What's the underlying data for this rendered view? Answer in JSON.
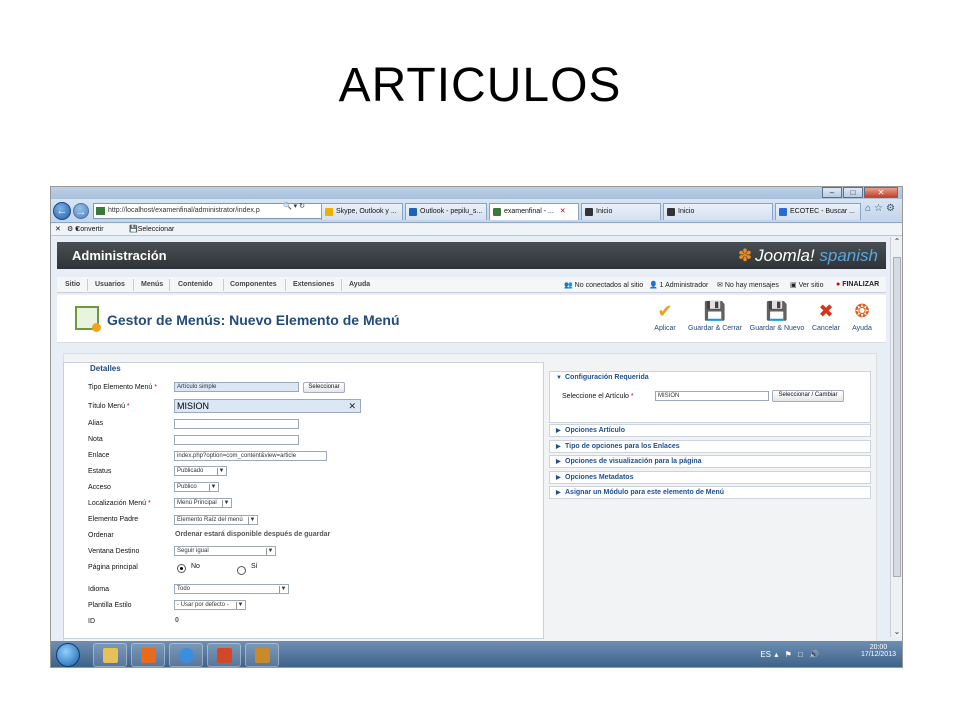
{
  "slide_title": "ARTICULOS",
  "browser": {
    "address": "http://localhost/examenfinal/administrator/index.p",
    "tabs": [
      "Skype, Outlook y ...",
      "Outlook - pepilu_s...",
      "examenfinal - ...",
      "Inicio",
      "Inicio",
      "ECOTEC - Buscar ..."
    ],
    "fav_convert": "Convertir",
    "fav_select": "Seleccionar"
  },
  "joomla": {
    "admin_title": "Administración",
    "logo_text": "Joomla!",
    "logo_suffix": "spanish",
    "menu": [
      "Sitio",
      "Usuarios",
      "Menús",
      "Contenido",
      "Componentes",
      "Extensiones",
      "Ayuda"
    ],
    "status": {
      "not_connected": "No conectados al sitio",
      "admin": "1 Administrador",
      "messages": "No hay mensajes",
      "view_site": "Ver sitio",
      "finish": "FINALIZAR"
    },
    "page_title": "Gestor de Menús: Nuevo Elemento de Menú",
    "toolbar": {
      "apply": "Aplicar",
      "save_close": "Guardar & Cerrar",
      "save_new": "Guardar & Nuevo",
      "cancel": "Cancelar",
      "help": "Ayuda"
    }
  },
  "details": {
    "legend": "Detalles",
    "type_label": "Tipo Elemento Menú",
    "type_value": "Artículo simple",
    "type_button": "Seleccionar",
    "title_label": "Título Menú",
    "title_value": "MISION",
    "alias_label": "Alias",
    "note_label": "Nota",
    "link_label": "Enlace",
    "link_value": "index.php?option=com_content&view=article",
    "status_label": "Estatus",
    "status_value": "Publicado",
    "access_label": "Acceso",
    "access_value": "Publico",
    "location_label": "Localización Menú",
    "location_value": "Menú Principal",
    "parent_label": "Elemento Padre",
    "parent_value": "Elemento Raíz del menú",
    "order_label": "Ordenar",
    "order_value": "Ordenar estará disponible después de guardar",
    "target_label": "Ventana Destino",
    "target_value": "Seguir igual",
    "home_label": "Página principal",
    "home_no": "No",
    "home_yes": "Sí",
    "lang_label": "Idioma",
    "lang_value": "Todo",
    "style_label": "Plantilla Estilo",
    "style_value": "- Usar por defecto -",
    "id_label": "ID",
    "id_value": "0",
    "required_star": "*"
  },
  "side_panels": {
    "required_title": "Configuración Requerida",
    "select_article_label": "Seleccione el Artículo",
    "select_article_value": "MISION",
    "select_article_button": "Seleccionar / Cambiar",
    "items": [
      "Opciones Artículo",
      "Tipo de opciones para los Enlaces",
      "Opciones de visualización para la página",
      "Opciones Metadatos",
      "Asignar un Módulo para este elemento de Menú"
    ]
  },
  "taskbar": {
    "lang": "ES",
    "time": "20:00",
    "date": "17/12/2013"
  }
}
